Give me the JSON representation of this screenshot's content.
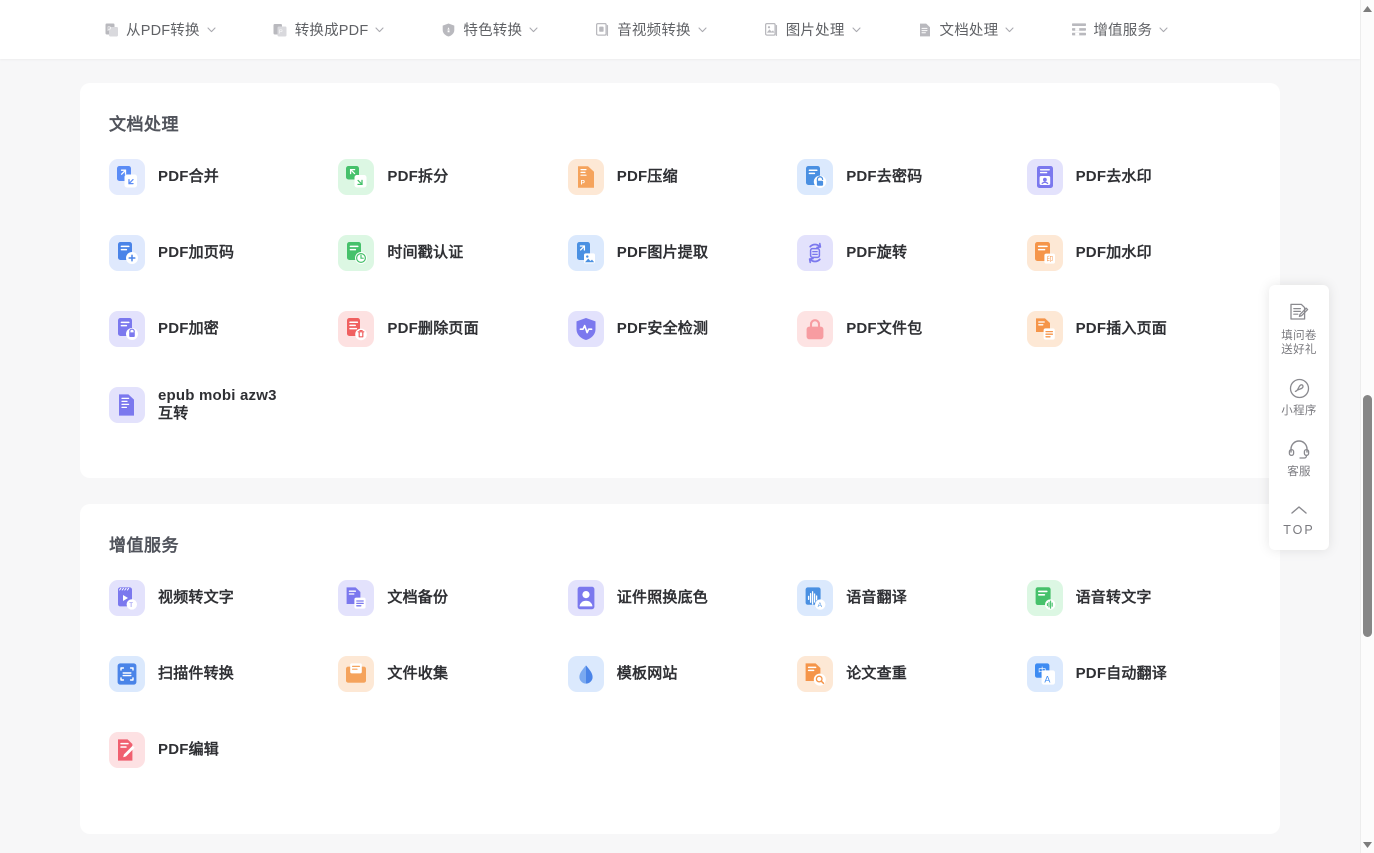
{
  "nav": {
    "items": [
      {
        "label": "从PDF转换",
        "icon": "from-pdf-icon",
        "caret": "⌄"
      },
      {
        "label": "转换成PDF",
        "icon": "to-pdf-icon",
        "caret": "⌄"
      },
      {
        "label": "特色转换",
        "icon": "shield-icon",
        "caret": "⌄"
      },
      {
        "label": "音视频转换",
        "icon": "media-icon",
        "caret": "⌄"
      },
      {
        "label": "图片处理",
        "icon": "image-icon",
        "caret": "⌄"
      },
      {
        "label": "文档处理",
        "icon": "document-icon",
        "caret": "⌄"
      },
      {
        "label": "增值服务",
        "icon": "list-icon",
        "caret": "⌄"
      }
    ]
  },
  "sections": [
    {
      "title": "文档处理",
      "tools": [
        {
          "label": "PDF合并",
          "icon": "pdf-merge-icon",
          "bg": "#e4ebfd",
          "fg": "#5b8cf6"
        },
        {
          "label": "PDF拆分",
          "icon": "pdf-split-icon",
          "bg": "#dcf7e3",
          "fg": "#46c16b"
        },
        {
          "label": "PDF压缩",
          "icon": "pdf-compress-icon",
          "bg": "#fde8d5",
          "fg": "#f5a35c"
        },
        {
          "label": "PDF去密码",
          "icon": "pdf-unlock-icon",
          "bg": "#dbe9fd",
          "fg": "#4a90e2"
        },
        {
          "label": "PDF去水印",
          "icon": "pdf-remove-mark-icon",
          "bg": "#e3e2fc",
          "fg": "#7b78ee"
        },
        {
          "label": "PDF加页码",
          "icon": "pdf-page-number-icon",
          "bg": "#dfe9fd",
          "fg": "#4a84e8"
        },
        {
          "label": "时间戳认证",
          "icon": "timestamp-icon",
          "bg": "#dcf7e3",
          "fg": "#46c16b"
        },
        {
          "label": "PDF图片提取",
          "icon": "pdf-extract-image-icon",
          "bg": "#dbe9fd",
          "fg": "#4a90e2"
        },
        {
          "label": "PDF旋转",
          "icon": "pdf-rotate-icon",
          "bg": "#e3e2fc",
          "fg": "#7b78ee"
        },
        {
          "label": "PDF加水印",
          "icon": "pdf-watermark-icon",
          "bg": "#fde8d5",
          "fg": "#f5954a"
        },
        {
          "label": "PDF加密",
          "icon": "pdf-lock-icon",
          "bg": "#e3e2fc",
          "fg": "#7b78ee"
        },
        {
          "label": "PDF删除页面",
          "icon": "pdf-delete-page-icon",
          "bg": "#fde1e1",
          "fg": "#f06060"
        },
        {
          "label": "PDF安全检测",
          "icon": "pdf-security-icon",
          "bg": "#e3e2fc",
          "fg": "#7b78ee"
        },
        {
          "label": "PDF文件包",
          "icon": "pdf-package-icon",
          "bg": "#fde3e3",
          "fg": "#f79ca1"
        },
        {
          "label": "PDF插入页面",
          "icon": "pdf-insert-page-icon",
          "bg": "#fde8d5",
          "fg": "#f5954a"
        },
        {
          "label": "epub mobi azw3互转",
          "icon": "ebook-convert-icon",
          "bg": "#e3e2fc",
          "fg": "#7b78ee"
        }
      ]
    },
    {
      "title": "增值服务",
      "tools": [
        {
          "label": "视频转文字",
          "icon": "video-to-text-icon",
          "bg": "#e3e2fc",
          "fg": "#7b78ee"
        },
        {
          "label": "文档备份",
          "icon": "doc-backup-icon",
          "bg": "#e3e2fc",
          "fg": "#7b78ee"
        },
        {
          "label": "证件照换底色",
          "icon": "id-photo-icon",
          "bg": "#e3e2fc",
          "fg": "#7b78ee"
        },
        {
          "label": "语音翻译",
          "icon": "voice-translate-icon",
          "bg": "#dbe9fd",
          "fg": "#4a90e2"
        },
        {
          "label": "语音转文字",
          "icon": "voice-to-text-icon",
          "bg": "#dcf7e3",
          "fg": "#46c16b"
        },
        {
          "label": "扫描件转换",
          "icon": "scan-convert-icon",
          "bg": "#dbe9fd",
          "fg": "#4a84e8"
        },
        {
          "label": "文件收集",
          "icon": "file-collect-icon",
          "bg": "#fde8d5",
          "fg": "#f5a35c"
        },
        {
          "label": "模板网站",
          "icon": "template-site-icon",
          "bg": "#dbe9fd",
          "fg": "#4a84e8"
        },
        {
          "label": "论文查重",
          "icon": "plagiarism-check-icon",
          "bg": "#fde8d5",
          "fg": "#f5954a"
        },
        {
          "label": "PDF自动翻译",
          "icon": "pdf-translate-icon",
          "bg": "#dbe9fd",
          "fg": "#3d8bf2"
        },
        {
          "label": "PDF编辑",
          "icon": "pdf-edit-icon",
          "bg": "#fde1e3",
          "fg": "#f06070"
        }
      ]
    }
  ],
  "dock": {
    "items": [
      {
        "label": "填问卷\n送好礼",
        "line1": "填问卷",
        "line2": "送好礼",
        "icon": "survey-icon"
      },
      {
        "label": "小程序",
        "icon": "miniprogram-icon"
      },
      {
        "label": "客服",
        "icon": "headset-icon"
      },
      {
        "label": "TOP",
        "icon": "chevron-up-icon"
      }
    ]
  },
  "scrollbar": {
    "up_arrow": "▲",
    "down_arrow": "▼"
  },
  "colors": {
    "page_bg": "#f7f7f8",
    "card_bg": "#ffffff",
    "nav_text": "#606266",
    "title_text": "#51545c",
    "tool_text": "#2f3034"
  }
}
